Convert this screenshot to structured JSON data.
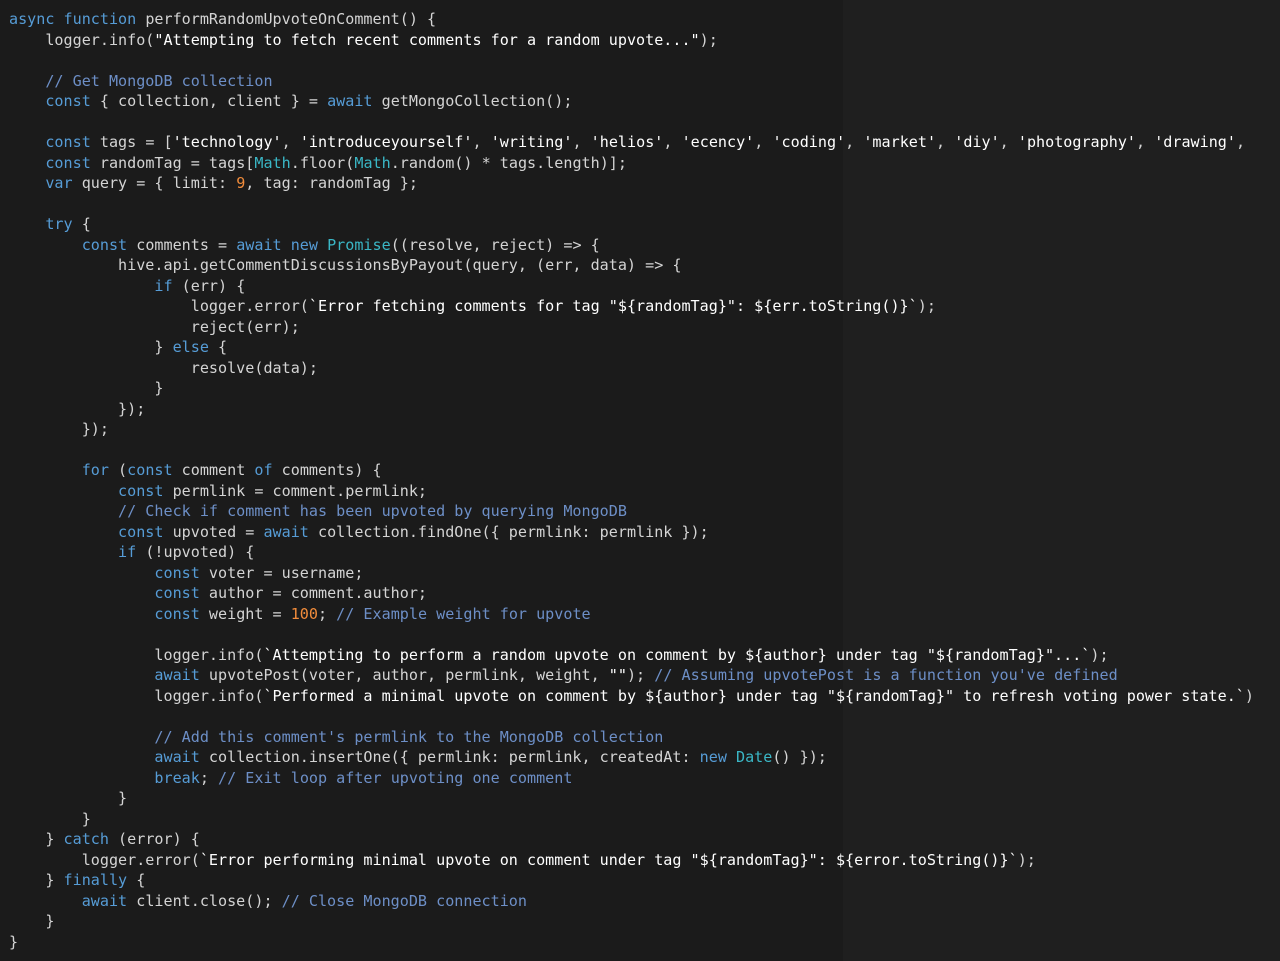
{
  "editor": {
    "lines": [
      [
        [
          "kw",
          "async"
        ],
        [
          "tx",
          " "
        ],
        [
          "kw",
          "function"
        ],
        [
          "tx",
          " performRandomUpvoteOnComment() {"
        ]
      ],
      [
        [
          "tx",
          "    logger.info("
        ],
        [
          "str",
          "\"Attempting to fetch recent comments for a random upvote...\""
        ],
        [
          "tx",
          ");"
        ]
      ],
      [],
      [
        [
          "cm",
          "    // Get MongoDB collection"
        ]
      ],
      [
        [
          "kw",
          "    const"
        ],
        [
          "tx",
          " { collection, client } = "
        ],
        [
          "kw",
          "await"
        ],
        [
          "tx",
          " getMongoCollection();"
        ]
      ],
      [],
      [
        [
          "kw",
          "    const"
        ],
        [
          "tx",
          " tags = ["
        ],
        [
          "str",
          "'technology'"
        ],
        [
          "tx",
          ", "
        ],
        [
          "str",
          "'introduceyourself'"
        ],
        [
          "tx",
          ", "
        ],
        [
          "str",
          "'writing'"
        ],
        [
          "tx",
          ", "
        ],
        [
          "str",
          "'helios'"
        ],
        [
          "tx",
          ", "
        ],
        [
          "str",
          "'ecency'"
        ],
        [
          "tx",
          ", "
        ],
        [
          "str",
          "'coding'"
        ],
        [
          "tx",
          ", "
        ],
        [
          "str",
          "'market'"
        ],
        [
          "tx",
          ", "
        ],
        [
          "str",
          "'diy'"
        ],
        [
          "tx",
          ", "
        ],
        [
          "str",
          "'photography'"
        ],
        [
          "tx",
          ", "
        ],
        [
          "str",
          "'drawing'"
        ],
        [
          "tx",
          ","
        ]
      ],
      [
        [
          "kw",
          "    const"
        ],
        [
          "tx",
          " randomTag = tags["
        ],
        [
          "ty",
          "Math"
        ],
        [
          "tx",
          ".floor("
        ],
        [
          "ty",
          "Math"
        ],
        [
          "tx",
          ".random() * tags.length)];"
        ]
      ],
      [
        [
          "kw",
          "    var"
        ],
        [
          "tx",
          " query = { limit: "
        ],
        [
          "num",
          "9"
        ],
        [
          "tx",
          ", tag: randomTag };"
        ]
      ],
      [],
      [
        [
          "kw",
          "    try"
        ],
        [
          "tx",
          " {"
        ]
      ],
      [
        [
          "kw",
          "        const"
        ],
        [
          "tx",
          " comments = "
        ],
        [
          "kw",
          "await"
        ],
        [
          "tx",
          " "
        ],
        [
          "kw",
          "new"
        ],
        [
          "tx",
          " "
        ],
        [
          "ty",
          "Promise"
        ],
        [
          "tx",
          "((resolve, reject) => {"
        ]
      ],
      [
        [
          "tx",
          "            hive.api.getCommentDiscussionsByPayout(query, (err, data) => {"
        ]
      ],
      [
        [
          "kw",
          "                if"
        ],
        [
          "tx",
          " (err) {"
        ]
      ],
      [
        [
          "tx",
          "                    logger.error("
        ],
        [
          "str",
          "`Error fetching comments for tag \"${randomTag}\": ${err.toString()}`"
        ],
        [
          "tx",
          ");"
        ]
      ],
      [
        [
          "tx",
          "                    reject(err);"
        ]
      ],
      [
        [
          "tx",
          "                } "
        ],
        [
          "kw",
          "else"
        ],
        [
          "tx",
          " {"
        ]
      ],
      [
        [
          "tx",
          "                    resolve(data);"
        ]
      ],
      [
        [
          "tx",
          "                }"
        ]
      ],
      [
        [
          "tx",
          "            });"
        ]
      ],
      [
        [
          "tx",
          "        });"
        ]
      ],
      [],
      [
        [
          "kw",
          "        for"
        ],
        [
          "tx",
          " ("
        ],
        [
          "kw",
          "const"
        ],
        [
          "tx",
          " comment "
        ],
        [
          "kw",
          "of"
        ],
        [
          "tx",
          " comments) {"
        ]
      ],
      [
        [
          "kw",
          "            const"
        ],
        [
          "tx",
          " permlink = comment.permlink;"
        ]
      ],
      [
        [
          "cm",
          "            // Check if comment has been upvoted by querying MongoDB"
        ]
      ],
      [
        [
          "kw",
          "            const"
        ],
        [
          "tx",
          " upvoted = "
        ],
        [
          "kw",
          "await"
        ],
        [
          "tx",
          " collection.findOne({ permlink: permlink });"
        ]
      ],
      [
        [
          "kw",
          "            if"
        ],
        [
          "tx",
          " (!upvoted) {"
        ]
      ],
      [
        [
          "kw",
          "                const"
        ],
        [
          "tx",
          " voter = username;"
        ]
      ],
      [
        [
          "kw",
          "                const"
        ],
        [
          "tx",
          " author = comment.author;"
        ]
      ],
      [
        [
          "kw",
          "                const"
        ],
        [
          "tx",
          " weight = "
        ],
        [
          "num",
          "100"
        ],
        [
          "tx",
          "; "
        ],
        [
          "cm",
          "// Example weight for upvote"
        ]
      ],
      [],
      [
        [
          "tx",
          "                logger.info("
        ],
        [
          "str",
          "`Attempting to perform a random upvote on comment by ${author} under tag \"${randomTag}\"...`"
        ],
        [
          "tx",
          ");"
        ]
      ],
      [
        [
          "kw",
          "                await"
        ],
        [
          "tx",
          " upvotePost(voter, author, permlink, weight, "
        ],
        [
          "str",
          "\"\""
        ],
        [
          "tx",
          "); "
        ],
        [
          "cm",
          "// Assuming upvotePost is a function you've defined"
        ]
      ],
      [
        [
          "tx",
          "                logger.info("
        ],
        [
          "str",
          "`Performed a minimal upvote on comment by ${author} under tag \"${randomTag}\" to refresh voting power state.`"
        ],
        [
          "tx",
          ")"
        ]
      ],
      [],
      [
        [
          "cm",
          "                // Add this comment's permlink to the MongoDB collection"
        ]
      ],
      [
        [
          "kw",
          "                await"
        ],
        [
          "tx",
          " collection.insertOne({ permlink: permlink, createdAt: "
        ],
        [
          "kw",
          "new"
        ],
        [
          "tx",
          " "
        ],
        [
          "ty",
          "Date"
        ],
        [
          "tx",
          "() });"
        ]
      ],
      [
        [
          "kw",
          "                break"
        ],
        [
          "tx",
          "; "
        ],
        [
          "cm",
          "// Exit loop after upvoting one comment"
        ]
      ],
      [
        [
          "tx",
          "            }"
        ]
      ],
      [
        [
          "tx",
          "        }"
        ]
      ],
      [
        [
          "tx",
          "    } "
        ],
        [
          "kw",
          "catch"
        ],
        [
          "tx",
          " (error) {"
        ]
      ],
      [
        [
          "tx",
          "        logger.error("
        ],
        [
          "str",
          "`Error performing minimal upvote on comment under tag \"${randomTag}\": ${error.toString()}`"
        ],
        [
          "tx",
          ");"
        ]
      ],
      [
        [
          "tx",
          "    } "
        ],
        [
          "kw",
          "finally"
        ],
        [
          "tx",
          " {"
        ]
      ],
      [
        [
          "kw",
          "        await"
        ],
        [
          "tx",
          " client.close(); "
        ],
        [
          "cm",
          "// Close MongoDB connection"
        ]
      ],
      [
        [
          "tx",
          "    }"
        ]
      ],
      [
        [
          "tx",
          "}"
        ]
      ]
    ]
  },
  "colors": {
    "background": "#1b1b1b",
    "right_pane": "#1f1f1f",
    "text": "#d4d4d4",
    "keyword": "#569cd6",
    "string": "#ffffff",
    "comment": "#6d8fc7",
    "number": "#f28c3b",
    "type": "#3ab7c6"
  }
}
